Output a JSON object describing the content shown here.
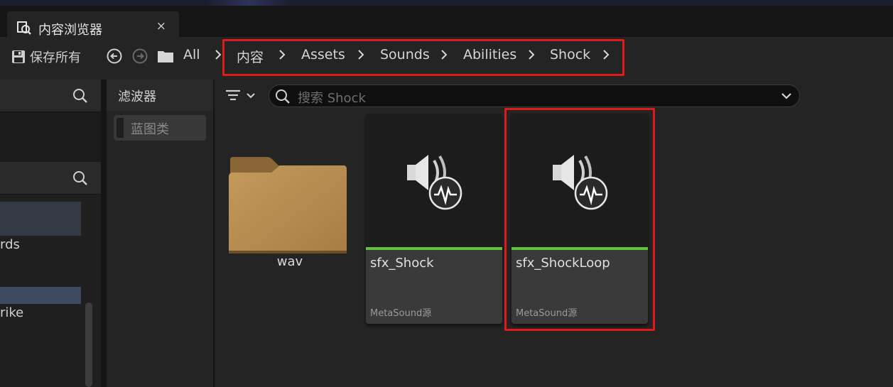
{
  "tab": {
    "title": "内容浏览器",
    "close": "×"
  },
  "toolbar": {
    "save_label": "保存所有",
    "breadcrumbs": [
      {
        "label": "All"
      },
      {
        "label": "内容"
      },
      {
        "label": "Assets"
      },
      {
        "label": "Sounds"
      },
      {
        "label": "Abilities"
      },
      {
        "label": "Shock"
      }
    ]
  },
  "sidebar": {
    "tree_items": [
      "rds",
      "rike"
    ]
  },
  "filters": {
    "title": "滤波器",
    "items": [
      {
        "label": "蓝图类"
      }
    ]
  },
  "content": {
    "search_placeholder": "搜索 Shock",
    "folder": {
      "name": "wav"
    },
    "assets": [
      {
        "name": "sfx_Shock",
        "type": "MetaSound源"
      },
      {
        "name": "sfx_ShockLoop",
        "type": "MetaSound源"
      }
    ]
  },
  "colors": {
    "highlight": "#e0191b",
    "asset_bar": "#62c13c",
    "folder": "#b58a4e"
  },
  "icons": {
    "tab": "content-browser-icon",
    "save": "save-icon",
    "back": "back-arrow-icon",
    "forward": "forward-arrow-icon",
    "folder": "folder-icon",
    "search": "search-icon",
    "filter": "filter-icon",
    "dropdown": "chevron-down-icon",
    "asset": "metasound-icon"
  }
}
